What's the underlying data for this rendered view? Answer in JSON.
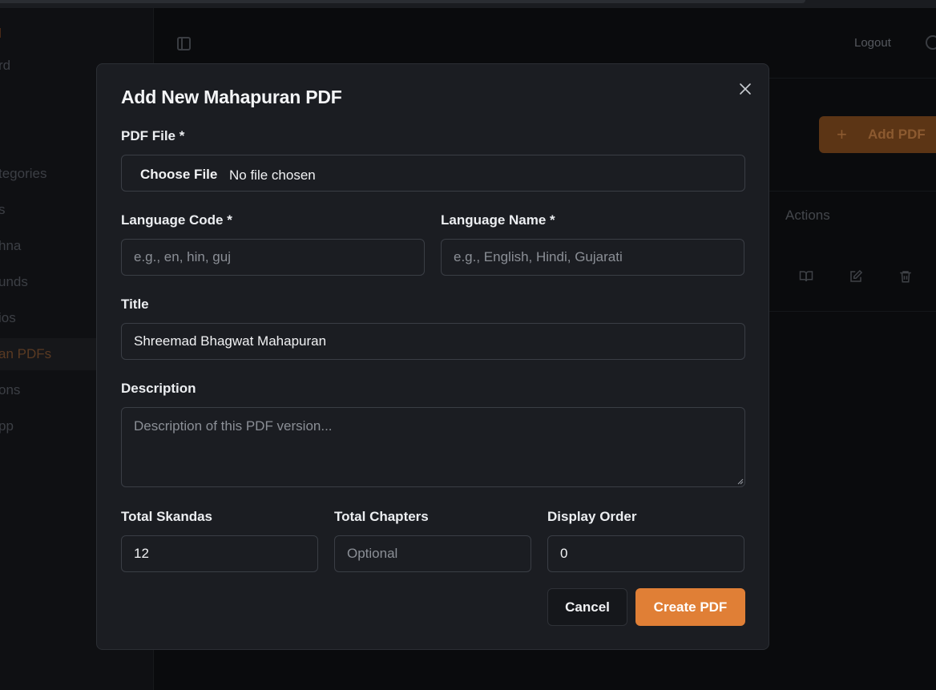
{
  "background": {
    "sidebar_items": [
      {
        "label": "l"
      },
      {
        "label": "rd"
      },
      {
        "label": "tegories"
      },
      {
        "label": "s"
      },
      {
        "label": "hna"
      },
      {
        "label": "unds"
      },
      {
        "label": "ios"
      },
      {
        "label": "an PDFs"
      },
      {
        "label": "ons"
      },
      {
        "label": "pp"
      }
    ],
    "header": {
      "logout_label": "Logout"
    },
    "add_pdf_label": "Add PDF",
    "actions_header": "Actions"
  },
  "dialog": {
    "title": "Add New Mahapuran PDF",
    "pdf_file": {
      "label": "PDF File *",
      "button": "Choose File",
      "status": "No file chosen"
    },
    "language_code": {
      "label": "Language Code *",
      "value": "",
      "placeholder": "e.g., en, hin, guj"
    },
    "language_name": {
      "label": "Language Name *",
      "value": "",
      "placeholder": "e.g., English, Hindi, Gujarati"
    },
    "title_field": {
      "label": "Title",
      "value": "Shreemad Bhagwat Mahapuran"
    },
    "description": {
      "label": "Description",
      "value": "",
      "placeholder": "Description of this PDF version..."
    },
    "total_skandas": {
      "label": "Total Skandas",
      "value": "12"
    },
    "total_chapters": {
      "label": "Total Chapters",
      "value": "",
      "placeholder": "Optional"
    },
    "display_order": {
      "label": "Display Order",
      "value": "0"
    },
    "cancel_label": "Cancel",
    "create_label": "Create PDF"
  },
  "colors": {
    "accent": "#e07f36",
    "dialog_bg": "#1b1d22",
    "page_bg": "#0b0c0e"
  }
}
